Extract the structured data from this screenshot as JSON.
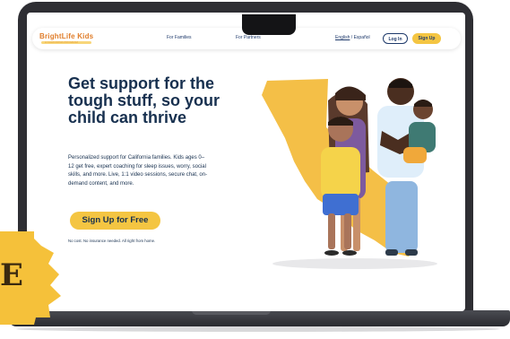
{
  "header": {
    "logo_text": "BrightLife Kids",
    "logo_tagline": "A CALIFORNIA PROGRAM",
    "nav": [
      "For Families",
      "For Partners"
    ],
    "lang_english": "English",
    "lang_separator": " / ",
    "lang_spanish": "Español",
    "login_label": "Log In",
    "signup_label": "Sign Up"
  },
  "hero": {
    "headline": "Get support for the tough stuff, so your child can thrive",
    "body": "Personalized support for California families. Kids ages 0–12 get free, expert coaching for sleep issues, worry, social skills, and more. Live, 1:1 video sessions, secure chat, on-demand content, and more.",
    "cta_label": "Sign Up for Free",
    "note": "No cost. No insurance needed. All right from home."
  },
  "badge": {
    "letter": "E"
  },
  "colors": {
    "accent": "#f4c542",
    "navy": "#17304f",
    "logo_orange": "#e07d2a",
    "map_yellow": "#f4bf47"
  }
}
